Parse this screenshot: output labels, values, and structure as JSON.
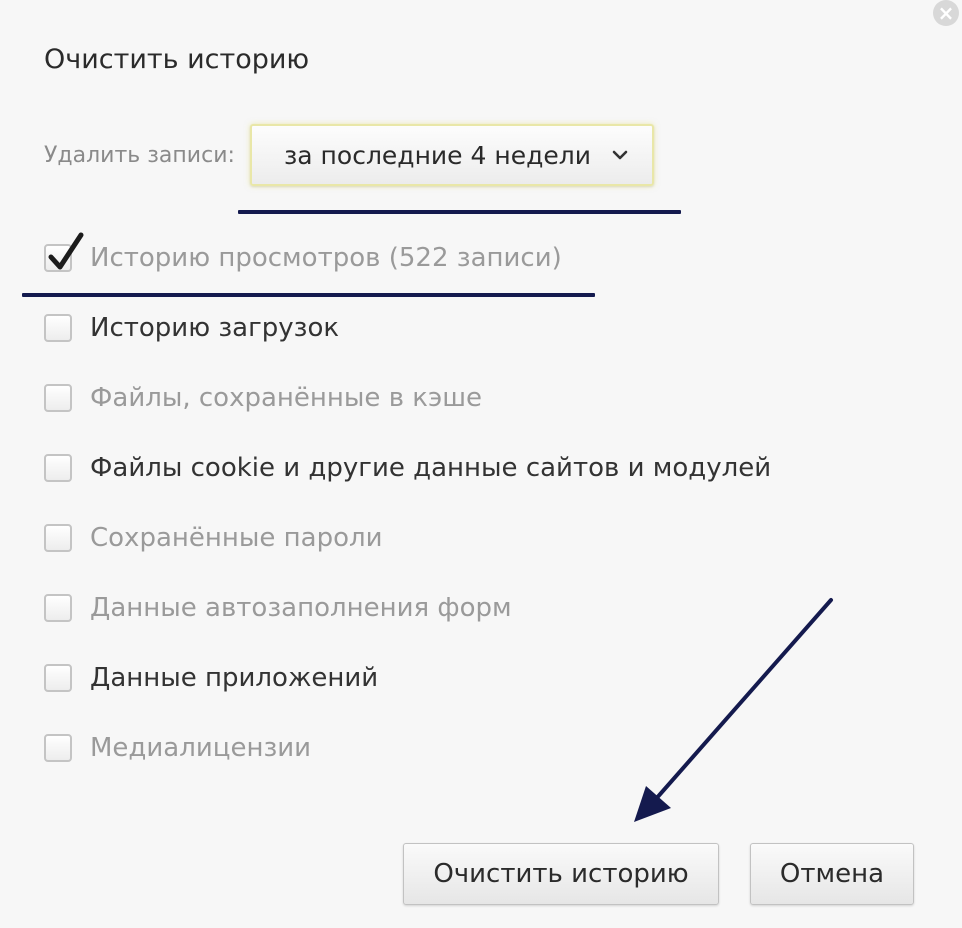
{
  "dialog": {
    "title": "Очистить историю",
    "delete_label": "Удалить записи:",
    "period_select": {
      "value": "за последние 4 недели"
    },
    "options": [
      {
        "label": "Историю просмотров (522 записи)",
        "checked": true
      },
      {
        "label": "Историю загрузок",
        "checked": false
      },
      {
        "label": "Файлы, сохранённые в кэше",
        "checked": false
      },
      {
        "label": "Файлы cookie и другие данные сайтов и модулей",
        "checked": false
      },
      {
        "label": "Сохранённые пароли",
        "checked": false
      },
      {
        "label": "Данные автозаполнения форм",
        "checked": false
      },
      {
        "label": "Данные приложений",
        "checked": false
      },
      {
        "label": "Медиалицензии",
        "checked": false
      }
    ],
    "buttons": {
      "clear": "Очистить историю",
      "cancel": "Отмена"
    }
  },
  "annotation_color": "#141a4e",
  "icons": {
    "close": "close-icon",
    "chevron": "chevron-down-icon",
    "checkmark": "checkmark-icon"
  }
}
